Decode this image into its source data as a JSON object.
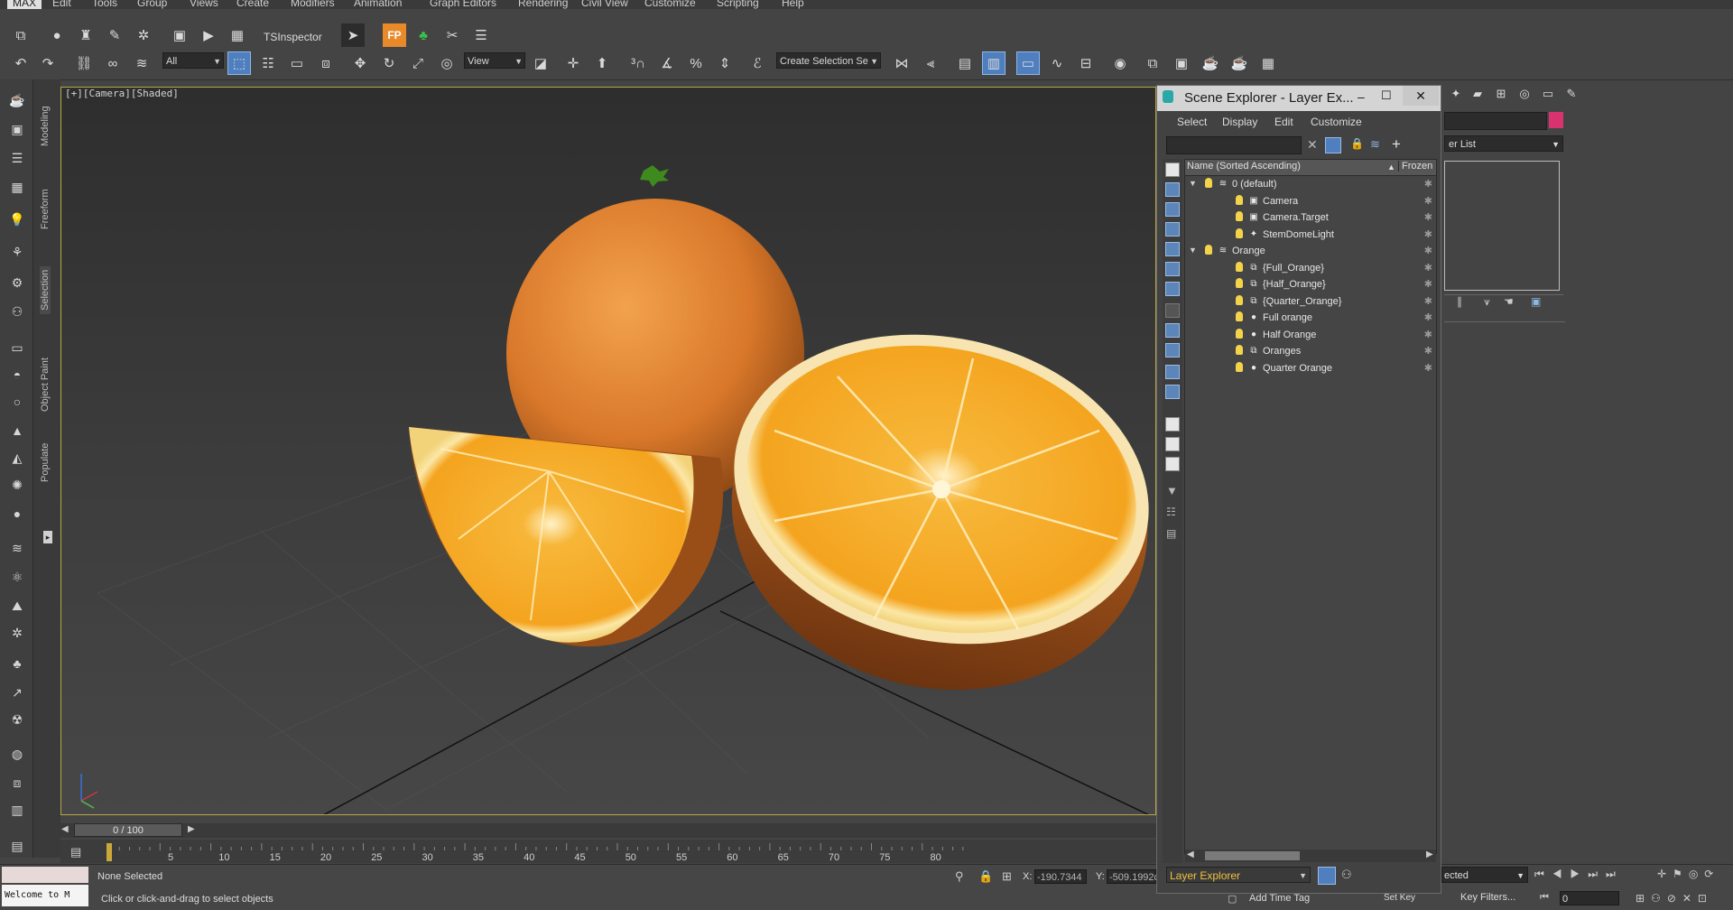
{
  "menu": [
    "Edit",
    "Tools",
    "Group",
    "Views",
    "Create",
    "Modifiers",
    "Animation",
    "Graph Editors",
    "Rendering",
    "Civil View",
    "Customize",
    "Scripting",
    "Help"
  ],
  "toolbar1": {
    "inspector_label": "TSInspector"
  },
  "toolbar2": {
    "filter_select": "All",
    "ref_coord_select": "View",
    "selection_set_placeholder": "Create Selection Se"
  },
  "ribbon_tabs": [
    "Modeling",
    "Freeform",
    "Selection",
    "Object Paint",
    "Populate"
  ],
  "viewport": {
    "label": "[+][Camera][Shaded]"
  },
  "timeline": {
    "slider": "0 / 100",
    "ticks": [
      "5",
      "10",
      "15",
      "20",
      "25",
      "30",
      "35",
      "40",
      "45",
      "50",
      "55",
      "60",
      "65",
      "70",
      "75",
      "80"
    ]
  },
  "status": {
    "maxscript": "Welcome to M",
    "selection": "None Selected",
    "prompt": "Click or click-and-drag to select objects",
    "x_label": "X:",
    "x_value": "-190.7344",
    "y_label": "Y:",
    "y_value": "-509.1992c",
    "add_time_tag": "Add Time Tag",
    "set_key": "Set Key",
    "key_filters": "Key Filters...",
    "selected_select": "ected",
    "frame_value": "0"
  },
  "scene_explorer": {
    "title": "Scene Explorer - Layer Ex...",
    "menu": [
      "Select",
      "Display",
      "Edit",
      "Customize"
    ],
    "col_name": "Name (Sorted Ascending)",
    "col_frozen": "Frozen",
    "rows": [
      {
        "name": "0 (default)",
        "level": 0,
        "expand": "▼",
        "icon": "≋"
      },
      {
        "name": "Camera",
        "level": 1,
        "expand": "",
        "icon": "▣"
      },
      {
        "name": "Camera.Target",
        "level": 1,
        "expand": "",
        "icon": "▣"
      },
      {
        "name": "StemDomeLight",
        "level": 1,
        "expand": "",
        "icon": "✦"
      },
      {
        "name": "Orange",
        "level": 0,
        "expand": "▼",
        "icon": "≋"
      },
      {
        "name": "{Full_Orange}",
        "level": 1,
        "expand": "",
        "icon": "⧉"
      },
      {
        "name": "{Half_Orange}",
        "level": 1,
        "expand": "",
        "icon": "⧉"
      },
      {
        "name": "{Quarter_Orange}",
        "level": 1,
        "expand": "",
        "icon": "⧉"
      },
      {
        "name": "Full orange",
        "level": 1,
        "expand": "",
        "icon": "●"
      },
      {
        "name": "Half Orange",
        "level": 1,
        "expand": "",
        "icon": "●"
      },
      {
        "name": "Oranges",
        "level": 1,
        "expand": "",
        "icon": "⧉"
      },
      {
        "name": "Quarter Orange",
        "level": 1,
        "expand": "",
        "icon": "●"
      }
    ],
    "footer_select": "Layer Explorer"
  },
  "command_panel": {
    "modifier_list": "er List"
  },
  "colors": {
    "accent": "#4f7fbf",
    "viewport_border": "#b9a64a",
    "orange": "#e8892a",
    "bulb": "#f3d34a",
    "magenta": "#d8336f"
  }
}
